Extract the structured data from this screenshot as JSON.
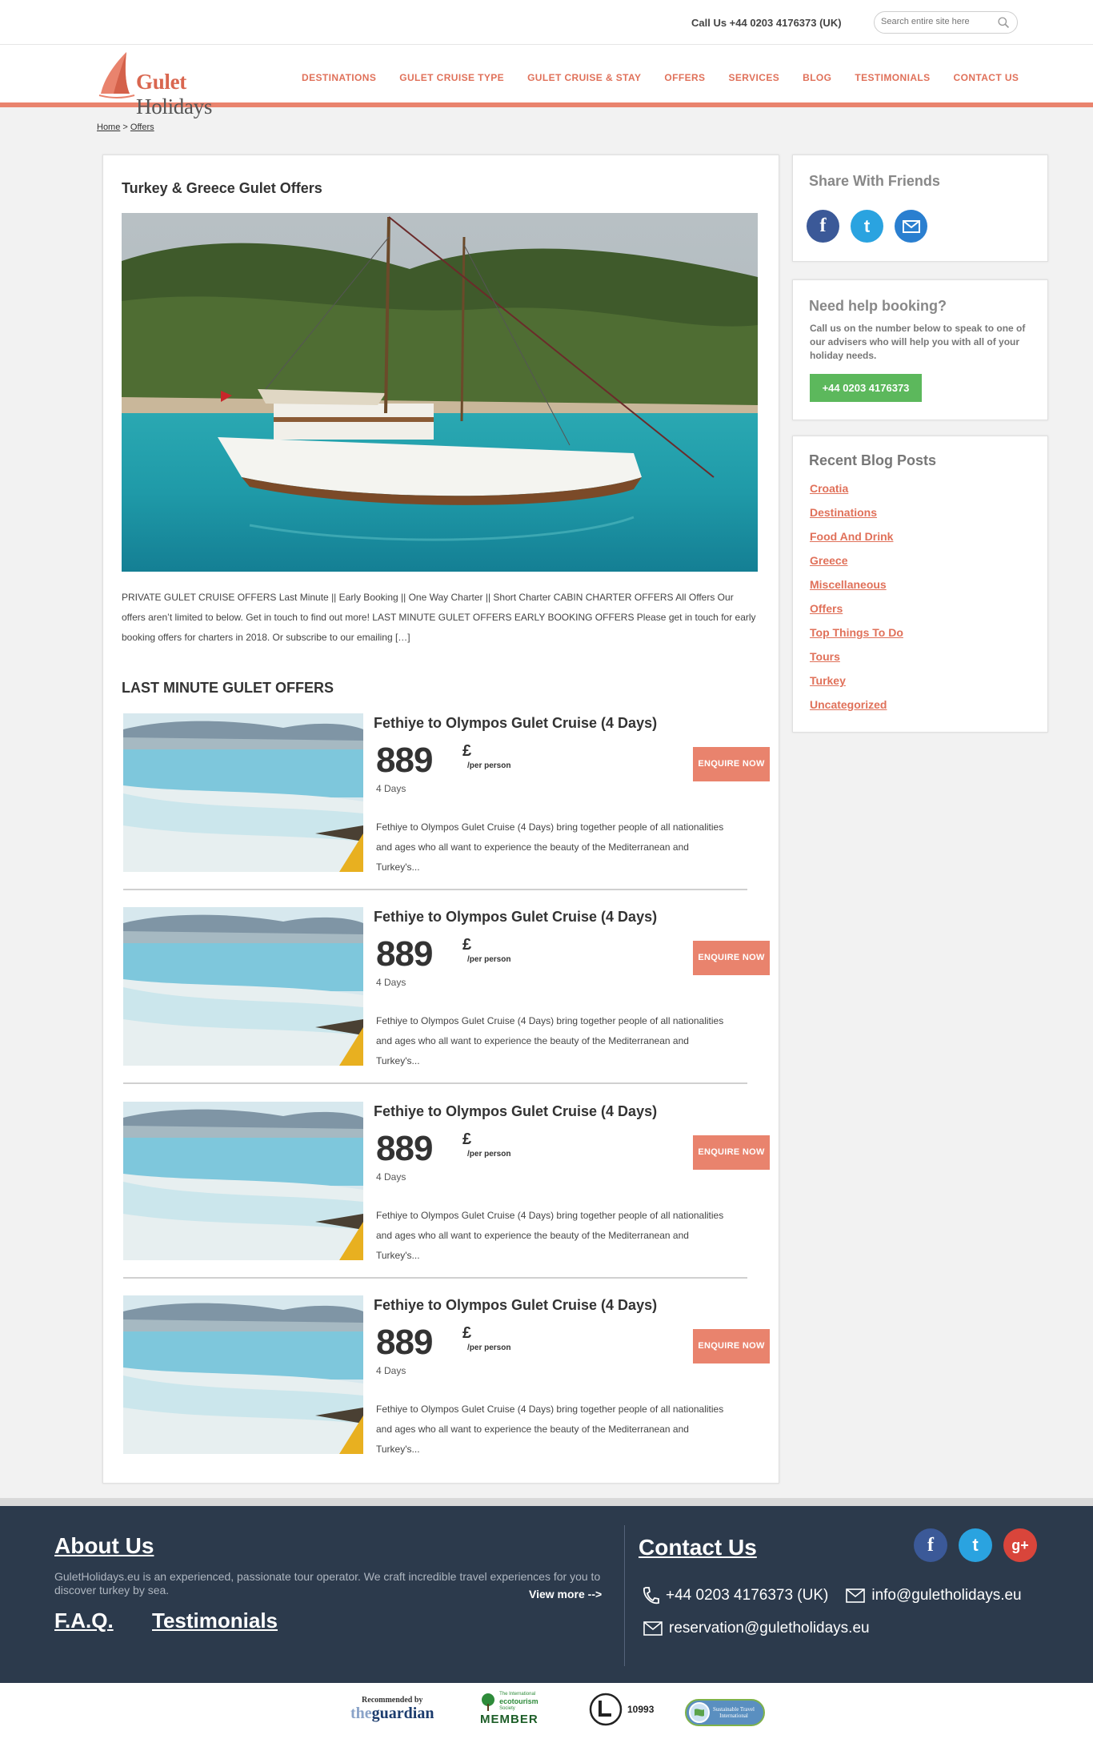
{
  "header": {
    "phone": "Call Us +44 0203 4176373 (UK)",
    "search_placeholder": "Search entire site here"
  },
  "logo": {
    "first": "Gulet",
    "second": " Holidays"
  },
  "nav": [
    "DESTINATIONS",
    "GULET CRUISE TYPE",
    "GULET CRUISE & STAY",
    "OFFERS",
    "SERVICES",
    "BLOG",
    "TESTIMONIALS",
    "CONTACT US"
  ],
  "breadcrumb": {
    "home": "Home",
    "sep": " > ",
    "current": "Offers"
  },
  "main": {
    "title": "Turkey & Greece Gulet Offers",
    "intro": "PRIVATE GULET CRUISE OFFERS  Last Minute  ||  Early Booking || One Way Charter  ||  Short Charter CABIN CHARTER OFFERS  All Offers Our offers aren’t limited to below. Get in touch to find out more! LAST MINUTE GULET OFFERS   EARLY BOOKING OFFERS Please get in touch for early booking offers for charters in 2018. Or subscribe to our emailing […]",
    "section_title": "LAST MINUTE GULET OFFERS",
    "offers": [
      {
        "title": "Fethiye to Olympos Gulet Cruise (4 Days)",
        "price": "889",
        "currency": "£",
        "per": "/per person",
        "days": "4 Days",
        "desc": "Fethiye to Olympos Gulet Cruise (4 Days) bring together people of  all nationalities and ages who all want to experience the beauty of the Mediterranean and Turkey's...",
        "button": "ENQUIRE NOW"
      },
      {
        "title": "Fethiye to Olympos Gulet Cruise (4 Days)",
        "price": "889",
        "currency": "£",
        "per": "/per person",
        "days": "4 Days",
        "desc": "Fethiye to Olympos Gulet Cruise (4 Days) bring together people of  all nationalities and ages who all want to experience the beauty of the Mediterranean and Turkey's...",
        "button": "ENQUIRE NOW"
      },
      {
        "title": "Fethiye to Olympos Gulet Cruise (4 Days)",
        "price": "889",
        "currency": "£",
        "per": "/per person",
        "days": "4 Days",
        "desc": "Fethiye to Olympos Gulet Cruise (4 Days) bring together people of  all nationalities and ages who all want to experience the beauty of the Mediterranean and Turkey's...",
        "button": "ENQUIRE NOW"
      },
      {
        "title": "Fethiye to Olympos Gulet Cruise (4 Days)",
        "price": "889",
        "currency": "£",
        "per": "/per person",
        "days": "4 Days",
        "desc": "Fethiye to Olympos Gulet Cruise (4 Days) bring together people of  all nationalities and ages who all want to experience the beauty of the Mediterranean and Turkey's...",
        "button": "ENQUIRE NOW"
      }
    ]
  },
  "sidebar": {
    "share_title": "Share With Friends",
    "help_title": "Need help booking?",
    "help_text": "Call us on the number below to speak to one of our advisers who will help you with all of your holiday needs.",
    "help_button": "+44 0203 4176373",
    "blog_title": "Recent Blog Posts",
    "blog_items": [
      "Croatia",
      "Destinations",
      "Food And Drink",
      "Greece",
      "Miscellaneous",
      "Offers",
      "Top Things To Do",
      "Tours",
      "Turkey",
      "Uncategorized"
    ]
  },
  "footer": {
    "about_title": "About Us",
    "about_text": "GuletHolidays.eu is an experienced, passionate tour operator. We craft incredible travel experiences for you to discover turkey by sea.",
    "view_more": "View more -->",
    "faq": "F.A.Q.",
    "testimonials": "Testimonials",
    "contact_title": "Contact Us",
    "phone": "+44 0203 4176373 (UK)",
    "email": "info@guletholidays.eu",
    "reservation": "reservation@guletholidays.eu"
  },
  "partners": {
    "guardian_top": "Recommended by",
    "guardian_the": "the",
    "guardian_name": "guardian",
    "ecotourism_top": "The International",
    "ecotourism_mid": "ecotourism",
    "ecotourism_sub": "Society",
    "ecotourism_member": "MEMBER",
    "license": "10993",
    "sti_name": "Sustainable Travel International"
  },
  "colors": {
    "accent": "#e9836d",
    "nav_text": "#e0715a",
    "help_button": "#5cb85c",
    "footer_bg": "#2c3a4c",
    "facebook": "#3b5998",
    "twitter": "#2aa3e0",
    "email": "#2a7fd0",
    "google_plus": "#d9453b"
  }
}
